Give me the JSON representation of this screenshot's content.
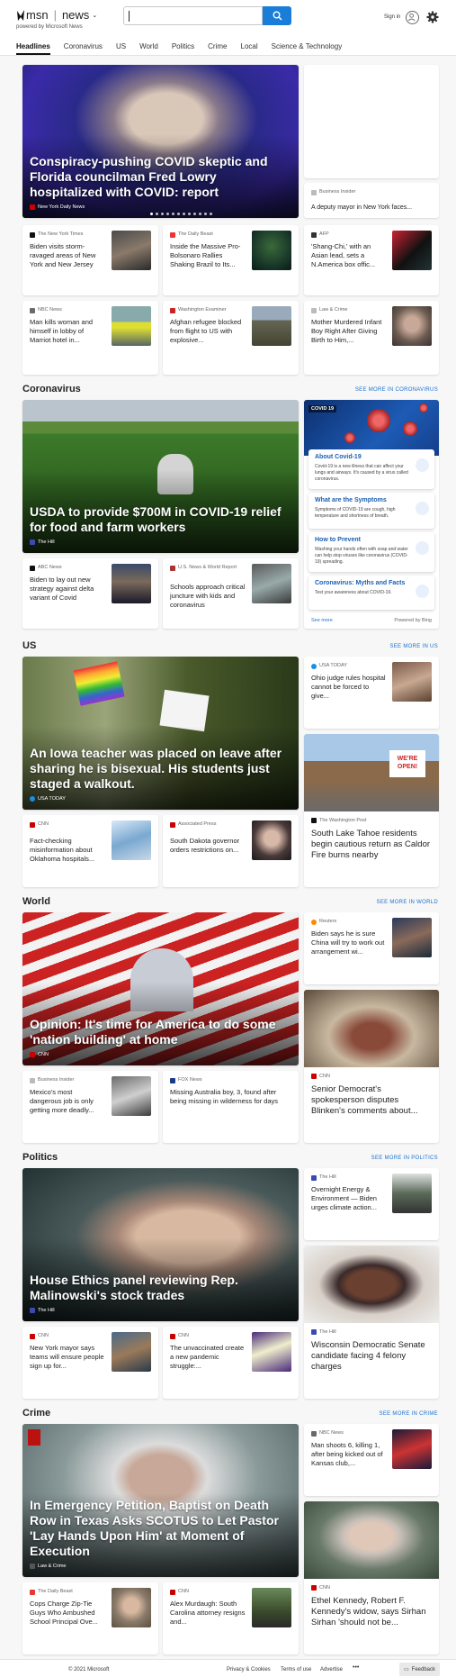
{
  "header": {
    "brand": "msn",
    "section": "news",
    "powered_by": "powered by Microsoft News",
    "search_placeholder": "",
    "sign_in": "Sign in",
    "nav": [
      "Headlines",
      "Coronavirus",
      "US",
      "World",
      "Politics",
      "Crime",
      "Local",
      "Science & Technology"
    ]
  },
  "top": {
    "hero": {
      "title": "Conspiracy-pushing COVID skeptic and Florida councilman Fred Lowry hospitalized with COVID: report",
      "source": "New York Daily News"
    },
    "side": {
      "source": "Business Insider",
      "title": "A deputy mayor in New York faces..."
    },
    "cards": [
      {
        "source": "The New York Times",
        "title": "Biden visits storm-ravaged areas of New York and New Jersey"
      },
      {
        "source": "The Daily Beast",
        "title": "Inside the Massive Pro-Bolsonaro Rallies Shaking Brazil to Its..."
      },
      {
        "source": "AFP",
        "title": "'Shang-Chi,' with an Asian lead, sets a N.America box offic..."
      },
      {
        "source": "NBC News",
        "title": "Man kills woman and himself in lobby of Marriot hotel in..."
      },
      {
        "source": "Washington Examiner",
        "title": "Afghan refugee blocked from flight to US with explosive..."
      },
      {
        "source": "Law & Crime",
        "title": "Mother Murdered Infant Boy Right After Giving Birth to Him,..."
      }
    ]
  },
  "coronavirus": {
    "heading": "Coronavirus",
    "see_more": "SEE MORE IN CORONAVIRUS",
    "hero": {
      "title": "USDA to provide $700M in COVID-19 relief for food and farm workers",
      "source": "The Hill"
    },
    "cards": [
      {
        "source": "ABC News",
        "title": "Biden to lay out new strategy against delta variant of Covid"
      },
      {
        "source": "U.S. News & World Report",
        "title": "Schools approach critical juncture with kids and coronavirus"
      }
    ],
    "panel": {
      "tag": "COVID 19",
      "tips": [
        {
          "title": "About Covid-19",
          "desc": "Covid-19 is a new illness that can affect your lungs and airways. It's caused by a virus called coronavirus."
        },
        {
          "title": "What are the Symptoms",
          "desc": "Symptoms of COVID-19 are cough, high temperature and shortness of breath."
        },
        {
          "title": "How to Prevent",
          "desc": "Washing your hands often with soap and water can help stop viruses like coronavirus (COVID-19) spreading."
        },
        {
          "title": "Coronavirus: Myths and Facts",
          "desc": "Test your awareness about COVID-19."
        }
      ],
      "see_more": "See more",
      "powered": "Powered by Bing"
    }
  },
  "us": {
    "heading": "US",
    "see_more": "SEE MORE IN US",
    "hero": {
      "title": "An Iowa teacher was placed on leave after sharing he is bisexual. His students just staged a walkout.",
      "source": "USA TODAY"
    },
    "side": {
      "source": "USA TODAY",
      "title": "Ohio judge rules hospital cannot be forced to give..."
    },
    "tall": {
      "source": "The Washington Post",
      "title": "South Lake Tahoe residents begin cautious return as Caldor Fire burns nearby",
      "sign": "WE'RE OPEN!"
    },
    "cards": [
      {
        "source": "CNN",
        "title": "Fact-checking misinformation about Oklahoma hospitals..."
      },
      {
        "source": "Associated Press",
        "title": "South Dakota governor orders restrictions on..."
      }
    ]
  },
  "world": {
    "heading": "World",
    "see_more": "SEE MORE IN WORLD",
    "hero": {
      "title": "Opinion: It's time for America to do some 'nation building' at home",
      "source": "CNN"
    },
    "side": {
      "source": "Reuters",
      "title": "Biden says he is sure China will try to work out arrangement wi..."
    },
    "tall": {
      "source": "CNN",
      "title": "Senior Democrat's spokesperson disputes Blinken's comments about..."
    },
    "cards": [
      {
        "source": "Business Insider",
        "title": "Mexico's most dangerous job is only getting more deadly..."
      },
      {
        "source": "FOX News",
        "title": "Missing Australia boy, 3, found after being missing in wilderness for days"
      }
    ]
  },
  "politics": {
    "heading": "Politics",
    "see_more": "SEE MORE IN POLITICS",
    "hero": {
      "title": "House Ethics panel reviewing Rep. Malinowski's stock trades",
      "source": "The Hill"
    },
    "side": {
      "source": "The Hill",
      "title": "Overnight Energy & Environment — Biden urges climate action..."
    },
    "tall": {
      "source": "The Hill",
      "title": "Wisconsin Democratic Senate candidate facing 4 felony charges"
    },
    "cards": [
      {
        "source": "CNN",
        "title": "New York mayor says teams will ensure people sign up for..."
      },
      {
        "source": "CNN",
        "title": "The unvaccinated create a new pandemic struggle:..."
      }
    ]
  },
  "crime": {
    "heading": "Crime",
    "see_more": "SEE MORE IN CRIME",
    "hero": {
      "title": "In Emergency Petition, Baptist on Death Row in Texas Asks SCOTUS to Let Pastor 'Lay Hands Upon Him' at Moment of Execution",
      "source": "Law & Crime"
    },
    "side": {
      "source": "NBC News",
      "title": "Man shoots 6, killing 1, after being kicked out of Kansas club,..."
    },
    "tall": {
      "source": "CNN",
      "title": "Ethel Kennedy, Robert F. Kennedy's widow, says Sirhan Sirhan 'should not be..."
    },
    "cards": [
      {
        "source": "The Daily Beast",
        "title": "Cops Charge Zip-Tie Guys Who Ambushed School Principal Ove..."
      },
      {
        "source": "CNN",
        "title": "Alex Murdaugh: South Carolina attorney resigns and..."
      }
    ]
  },
  "footer": {
    "copyright": "© 2021 Microsoft",
    "links": [
      "Privacy & Cookies",
      "Terms of use",
      "Advertise"
    ],
    "more": "•••",
    "feedback": "Feedback"
  },
  "colors": {
    "accent": "#1a7ed8",
    "link": "#1a73d0",
    "cnn": "#cc0000"
  }
}
